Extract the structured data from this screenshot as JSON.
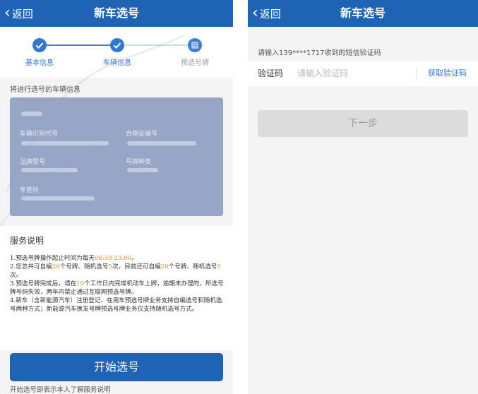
{
  "left": {
    "nav": {
      "back_label": "返回",
      "title": "新车选号"
    },
    "steps": [
      {
        "label": "基本信息",
        "state": "done"
      },
      {
        "label": "车辆信息",
        "state": "done"
      },
      {
        "label": "预选号牌",
        "state": "current"
      }
    ],
    "vehicle_section_hint": "将进行选号的车辆信息",
    "vehicle_card": {
      "vin_label": "车辆识别代号",
      "cert_label": "合格证编号",
      "model_label": "品牌型号",
      "plate_type_label": "号牌种类",
      "office_label": "车管所"
    },
    "service": {
      "title": "服务说明",
      "rule1": {
        "a": "1.预选号牌操作起止时间为每天",
        "time": "06:30-23:00",
        "b": "。"
      },
      "rule2": {
        "a": "2.您总共可自编",
        "n1": "20",
        "b": "个号牌、随机选号",
        "n2": "5",
        "c": "次，目前还可自编",
        "n3": "20",
        "d": "个号牌、随机选号",
        "n4": "5",
        "e": "次。"
      },
      "rule3": {
        "a": "3.预选号牌完成后，请在",
        "n": "10",
        "b": "个工作日内完成机动车上牌，逾期未办理的，所选号牌号码失效，两年内禁止通过互联网预选号牌。"
      },
      "rule4": "4.新车（含新能源汽车）注册登记、在用车预选号牌业务支持自编选号和随机选号两种方式；新能源汽车换发号牌预选号牌业务仅支持随机选号方式。"
    },
    "start_button": "开始选号",
    "start_note": "开始选号即表示本人了解服务说明"
  },
  "right": {
    "nav": {
      "back_label": "返回",
      "title": "新车选号"
    },
    "sms_hint": "请输入139****1717收到的短信验证码",
    "code_label": "验证码",
    "code_placeholder": "请输入验证码",
    "get_code_label": "获取验证码",
    "next_button": "下一步"
  },
  "colors": {
    "primary": "#1f63b5",
    "highlight": "#f08a1c",
    "card": "#97a5c7",
    "disabled": "#dcdcdc"
  },
  "icons": {
    "back": "chevron-left-icon",
    "done": "check-icon",
    "current": "plate-grid-icon"
  }
}
